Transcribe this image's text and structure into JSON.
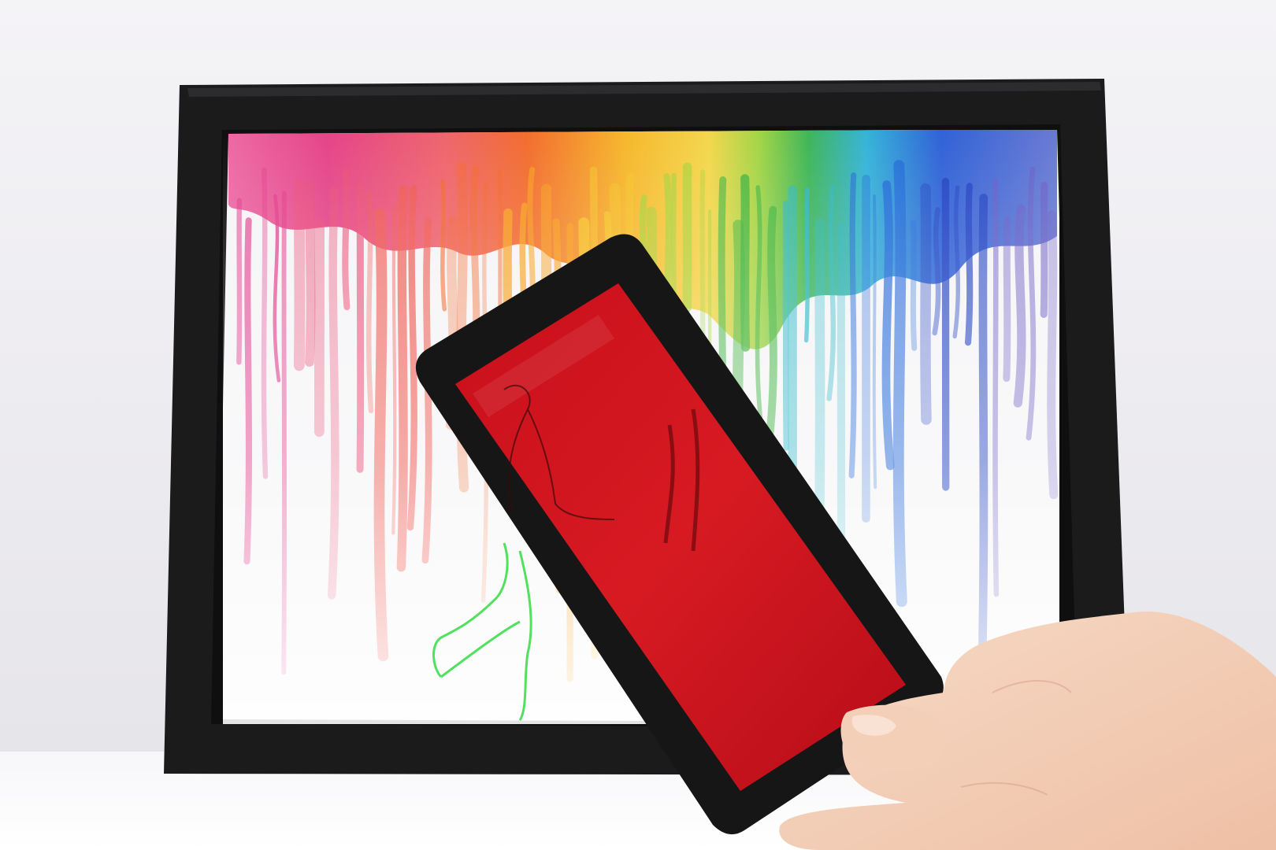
{
  "scene": {
    "subject": "",
    "colors": {
      "wall": "#f2f1f4",
      "table": "#fbfbfc",
      "frame": "#1a1a1a",
      "paper": "#f4f4f6",
      "filter_red": "#c4141e",
      "skin": "#f2cdb4",
      "figure_outline": "#4ce05a"
    },
    "drip_colors": [
      "#e23b8b",
      "#ea4f78",
      "#ef5a52",
      "#f2672c",
      "#f7a11f",
      "#f6c92a",
      "#9fd43a",
      "#3fb33f",
      "#2bb7c8",
      "#2166d8",
      "#1f3fbf",
      "#6b5bc2"
    ]
  }
}
